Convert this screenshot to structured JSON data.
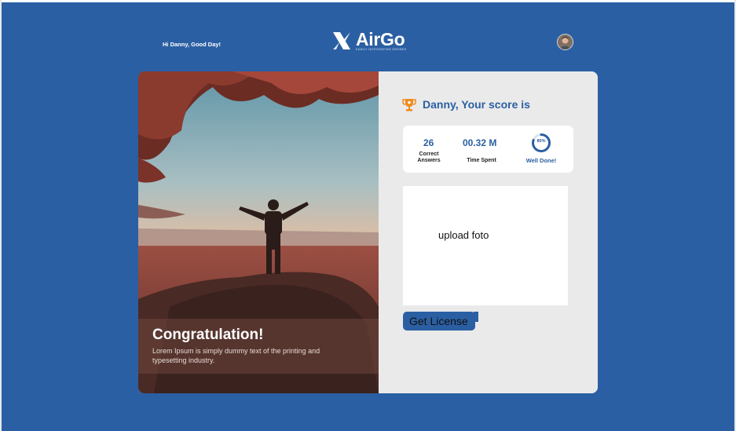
{
  "header": {
    "greeting": "Hi Danny, Good Day!",
    "logo_title": "AirGo",
    "logo_subtitle": "EASILY INTEGRATING DRONES"
  },
  "hero": {
    "title": "Congratulation!",
    "text": "Lorem Ipsum is simply dummy text of the printing and typesetting industry."
  },
  "score": {
    "heading": "Danny, Your score is",
    "correct_value": "26",
    "correct_label_1": "Correct",
    "correct_label_2": "Answers",
    "time_value": "00.32 M",
    "time_label": "Time Spent",
    "progress_percent": "80%",
    "progress_fraction": 0.8,
    "progress_label": "Well Done!"
  },
  "upload": {
    "label": "upload foto"
  },
  "actions": {
    "license_label": "Get License"
  },
  "colors": {
    "background": "#2b5fa3",
    "accent": "#2b5fa3",
    "trophy": "#f08a1c",
    "panel": "#eaeaea"
  }
}
